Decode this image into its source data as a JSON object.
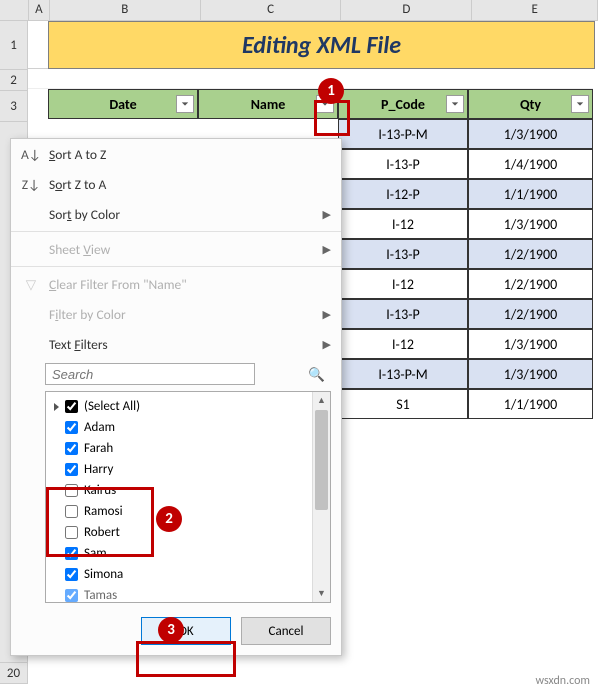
{
  "cols": {
    "A": "A",
    "B": "B",
    "C": "C",
    "D": "D",
    "E": "E"
  },
  "rownums": {
    "r1": "1",
    "r2": "2",
    "r3": "3",
    "r20": "20"
  },
  "title": "Editing XML File",
  "headers": {
    "date": "Date",
    "name": "Name",
    "pcode": "P_Code",
    "qty": "Qty"
  },
  "data": [
    {
      "pcode": "I-13-P-M",
      "qty": "1/3/1900"
    },
    {
      "pcode": "I-13-P",
      "qty": "1/4/1900"
    },
    {
      "pcode": "I-12-P",
      "qty": "1/1/1900"
    },
    {
      "pcode": "I-12",
      "qty": "1/3/1900"
    },
    {
      "pcode": "I-13-P",
      "qty": "1/2/1900"
    },
    {
      "pcode": "I-12",
      "qty": "1/2/1900"
    },
    {
      "pcode": "I-13-P",
      "qty": "1/2/1900"
    },
    {
      "pcode": "I-12",
      "qty": "1/3/1900"
    },
    {
      "pcode": "I-13-P-M",
      "qty": "1/3/1900"
    },
    {
      "pcode": "S1",
      "qty": "1/1/1900"
    }
  ],
  "menu": {
    "sort_az_pre": "S",
    "sort_az": "ort A to Z",
    "sort_za_pre": "S",
    "sort_za_u": "o",
    "sort_za": "rt Z to A",
    "sort_color_pre": "Sor",
    "sort_color_u": "t",
    "sort_color": " by Color",
    "sheet_view": "Sheet ",
    "sheet_view_u": "V",
    "sheet_view2": "iew",
    "clear_pre": "",
    "clear_u": "C",
    "clear": "lear Filter From \"Name\"",
    "filter_color_pre": "F",
    "filter_color_u": "i",
    "filter_color": "lter by Color",
    "text_filters_pre": "Text ",
    "text_filters_u": "F",
    "text_filters": "ilters",
    "search_ph": "Search",
    "items": {
      "all": "(Select All)",
      "adam": "Adam",
      "farah": "Farah",
      "harry": "Harry",
      "kairus": "Kairus",
      "ramosi": "Ramosi",
      "robert": "Robert",
      "sam": "Sam",
      "simona": "Simona",
      "tamas": "Tamas"
    },
    "ok": "OK",
    "cancel": "Cancel"
  },
  "callouts": {
    "c1": "1",
    "c2": "2",
    "c3": "3"
  },
  "watermark": "wsxdn.com"
}
